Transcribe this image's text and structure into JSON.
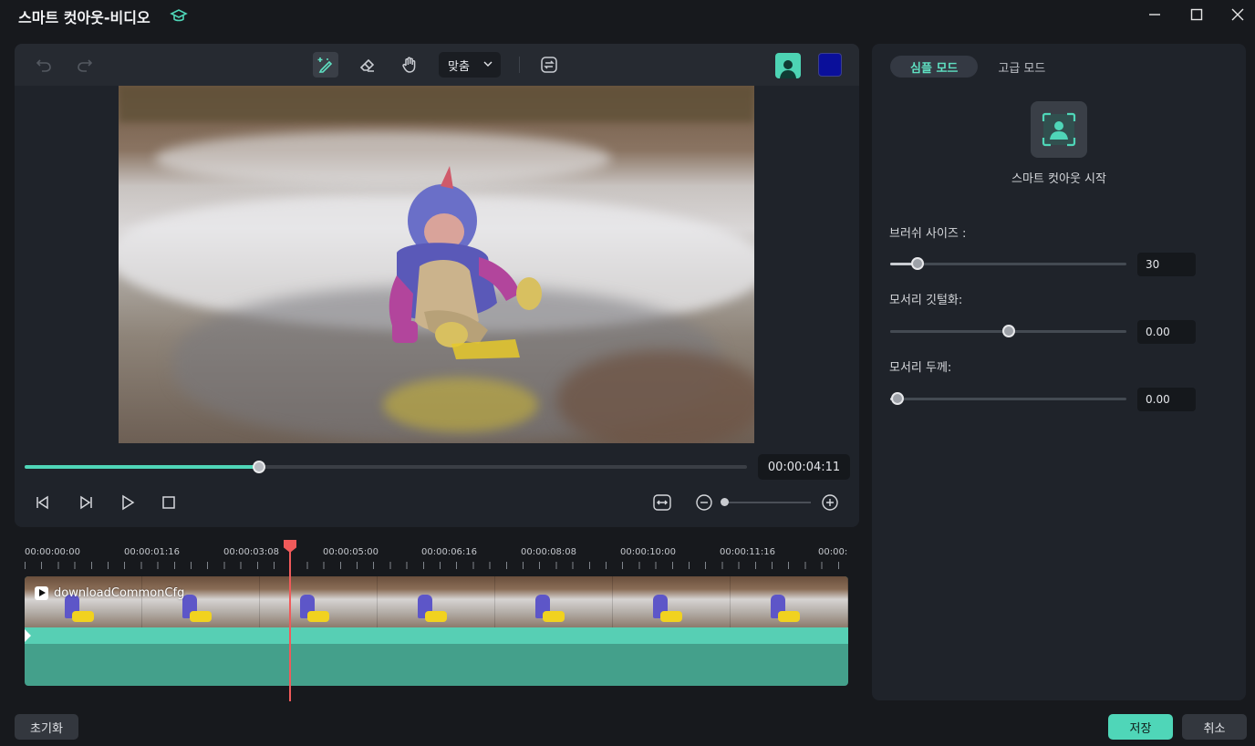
{
  "window": {
    "title": "스마트 컷아웃-비디오",
    "controls": [
      "minimize-icon",
      "maximize-icon",
      "close-icon"
    ]
  },
  "toolbar": {
    "undo_icon": "undo-icon",
    "redo_icon": "redo-icon",
    "brush_icon": "smart-brush-icon",
    "eraser_icon": "eraser-icon",
    "hand_icon": "hand-icon",
    "fit_select": "맞춤",
    "swap_icon": "swap-icon",
    "overlay_color": "#0a0f9a"
  },
  "player": {
    "progress": 0.325,
    "timecode": "00:00:04:11",
    "controls": [
      "prev-frame-icon",
      "next-frame-icon",
      "play-icon",
      "stop-icon",
      "fit-timeline-icon",
      "zoom-out-icon",
      "zoom-in-icon"
    ]
  },
  "timeline": {
    "ruler_labels": [
      "00:00:00:00",
      "00:00:01:16",
      "00:00:03:08",
      "00:00:05:00",
      "00:00:06:16",
      "00:00:08:08",
      "00:00:10:00",
      "00:00:11:16",
      "00:00:"
    ],
    "clip_name": "downloadCommonCfg",
    "thumbnail_count": 7
  },
  "side_panel": {
    "tabs": [
      "심플 모드",
      "고급 모드"
    ],
    "active_tab": 0,
    "start_label": "스마트 컷아웃 시작",
    "params": [
      {
        "label": "브러쉬 사이즈 :",
        "value": "30",
        "fraction": 0.117
      },
      {
        "label": "모서리 깃털화:",
        "value": "0.00",
        "fraction": 0.5
      },
      {
        "label": "모서리 두께:",
        "value": "0.00",
        "fraction": 0.03
      }
    ]
  },
  "footer": {
    "reset": "초기화",
    "save": "저장",
    "cancel": "취소"
  },
  "colors": {
    "accent": "#4fd6b8",
    "playhead": "#f05a5a",
    "panel": "#1f232a",
    "background": "#17191d"
  }
}
